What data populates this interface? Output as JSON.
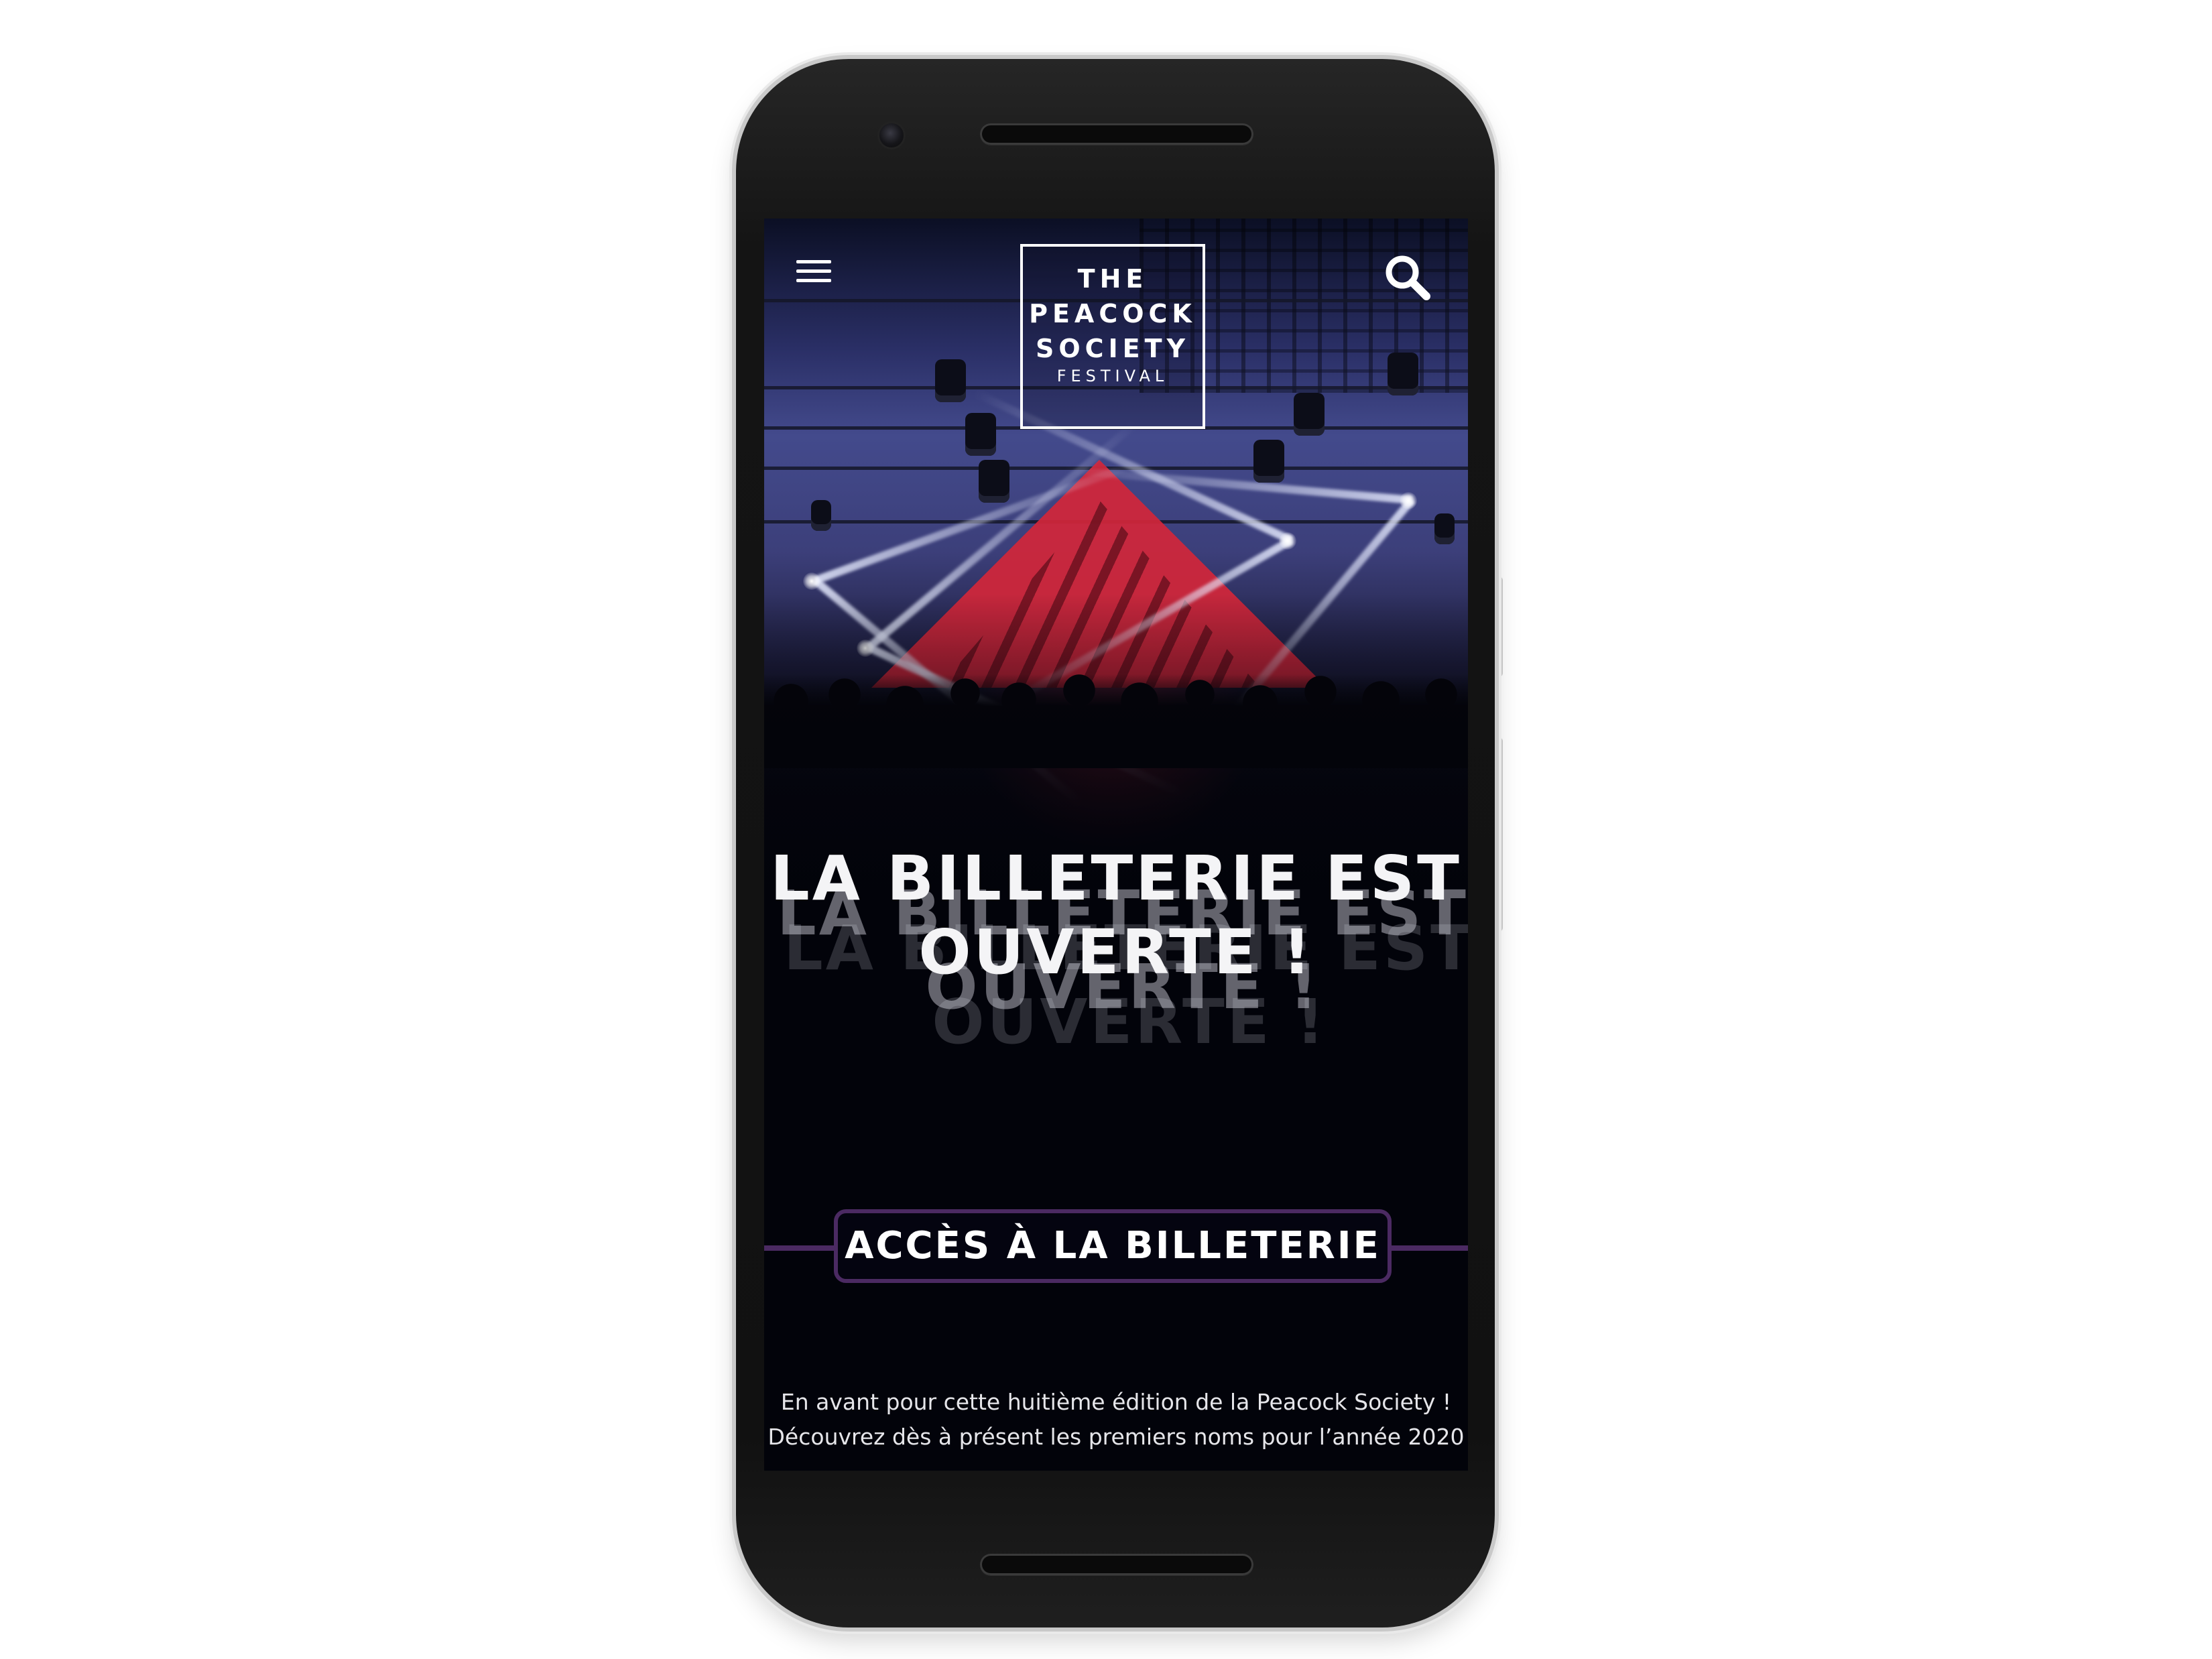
{
  "header": {
    "logo_lines": [
      "THE",
      "PEACOCK",
      "SOCIETY",
      "FESTIVAL"
    ],
    "menu_icon": "hamburger-menu-icon",
    "search_icon": "search-icon"
  },
  "hero": {
    "headline_line1": "LA BILLETERIE EST",
    "headline_line2": "OUVERTE !"
  },
  "cta": {
    "label": "ACCÈS À LA BILLETERIE",
    "accent_color": "#4b2a62"
  },
  "intro": {
    "line1": "En avant pour cette huitième édition de la Peacock Society !",
    "line2": "Découvrez dès à présent les premiers noms pour l’année 2020"
  }
}
